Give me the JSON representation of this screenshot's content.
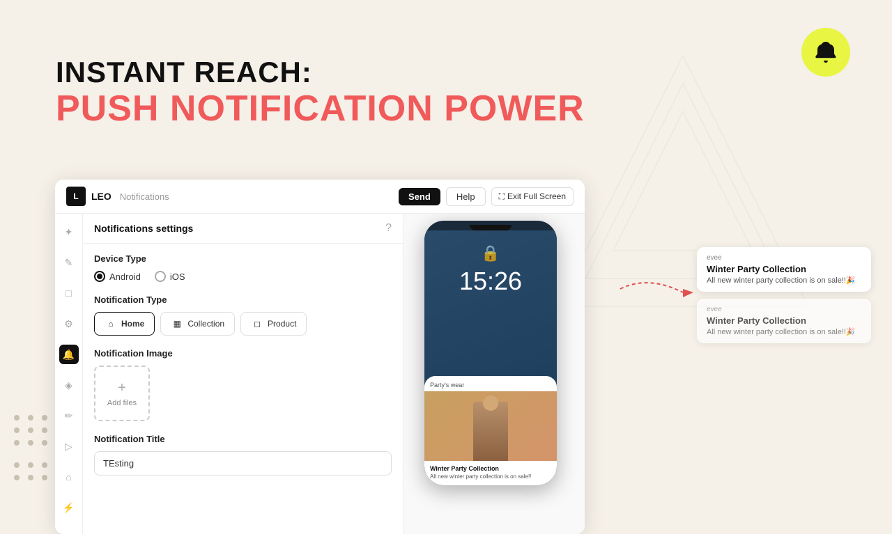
{
  "hero": {
    "line1": "INSTANT REACH:",
    "line2": "PUSH NOTIFICATION POWER"
  },
  "app": {
    "logo_text": "LEO",
    "section": "Notifications",
    "buttons": {
      "send": "Send",
      "help": "Help",
      "fullscreen": "Exit Full Screen"
    }
  },
  "settings": {
    "title": "Notifications settings",
    "device_type_label": "Device Type",
    "android_label": "Android",
    "ios_label": "iOS",
    "android_checked": true,
    "notification_type_label": "Notification Type",
    "type_options": [
      "Home",
      "Collection",
      "Product"
    ],
    "active_type": "Home",
    "notification_image_label": "Notification Image",
    "add_files_label": "Add files",
    "notification_title_label": "Notification Title",
    "notification_title_value": "TEsting"
  },
  "phone": {
    "time": "15:26",
    "content_label": "Party's wear",
    "product_title": "Winter Party Collection",
    "product_sub": "All new winter party collection is on sale!!"
  },
  "notifications": [
    {
      "brand": "evee",
      "title": "Winter Party Collection",
      "text": "All new winter party collection is on sale!!🎉"
    },
    {
      "brand": "evee",
      "title": "Winter Party Collection",
      "text": "All new winter party collection is on sale!!🎉"
    }
  ],
  "sidebar_icons": [
    "✦",
    "✎",
    "□",
    "⚙",
    "🔔",
    "◈",
    "✏",
    "▷",
    "⌂",
    "⚡"
  ]
}
